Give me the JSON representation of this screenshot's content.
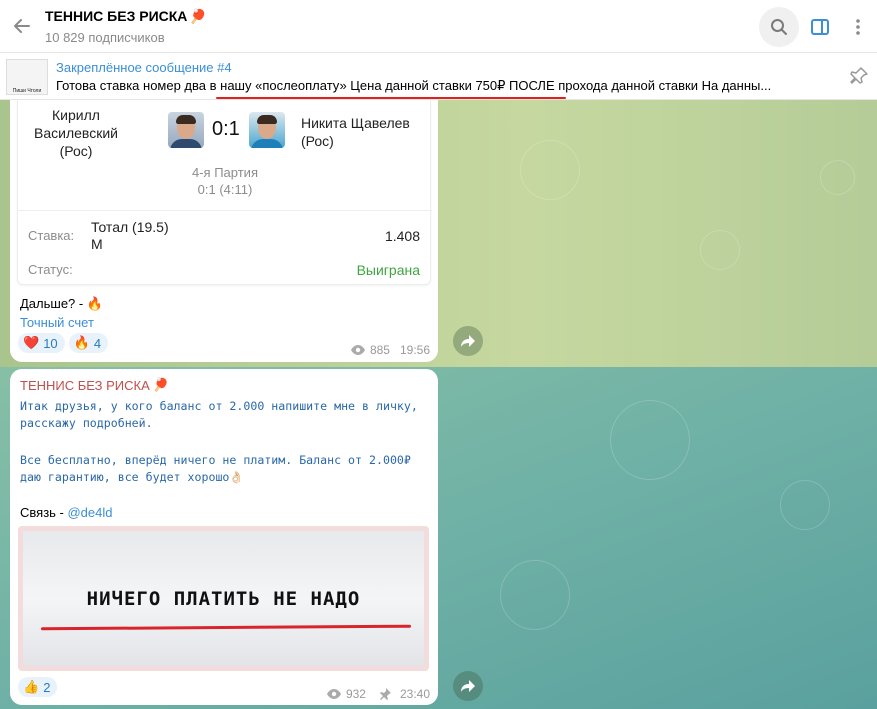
{
  "header": {
    "title": "ТЕННИС БЕЗ РИСКА",
    "title_emoji": "🏓",
    "subscribers": "10 829 подписчиков"
  },
  "pinned": {
    "title": "Закреплённое сообщение #4",
    "text": "Готова ставка номер два в нашу «послеоплату» Цена данной ставки 750₽ ПОСЛЕ прохода данной ставки  На данны...",
    "thumb_text": "Пиши Чтоли"
  },
  "message1": {
    "player_left": "Кирилл Василевский (Рос)",
    "player_right": "Никита Щавелев (Рос)",
    "score": "0:1",
    "set_label": "4-я Партия",
    "set_score": "0:1 (4:11)",
    "bet_label": "Ставка:",
    "bet_name": "Тотал (19.5) М",
    "bet_odds": "1.408",
    "status_label": "Статус:",
    "status_value": "Выиграна",
    "text": "Дальше? - 🔥",
    "link": "Точный счет",
    "reactions": [
      {
        "emoji": "❤️",
        "count": "10"
      },
      {
        "emoji": "🔥",
        "count": "4"
      }
    ],
    "views": "885",
    "time": "19:56"
  },
  "message2": {
    "sender": "ТЕННИС БЕЗ РИСКА",
    "sender_emoji": "🏓",
    "line1": "Итак друзья, у кого баланс от 2.000 напишите мне в личку,",
    "line2": "расскажу подробней.",
    "line3": "Все бесплатно, вперёд ничего не платим. Баланс от 2.000₽",
    "line4": "даю гарантию, все будет хорошо👌🏻",
    "contact_label": "Связь - ",
    "contact_link": "@de4ld",
    "banner_text": "НИЧЕГО ПЛАТИТЬ НЕ НАДО",
    "reactions": [
      {
        "emoji": "👍",
        "count": "2"
      }
    ],
    "views": "932",
    "time": "23:40"
  },
  "colors": {
    "accent": "#3a8fd6",
    "sender": "#c0504d",
    "success": "#3fa541"
  }
}
